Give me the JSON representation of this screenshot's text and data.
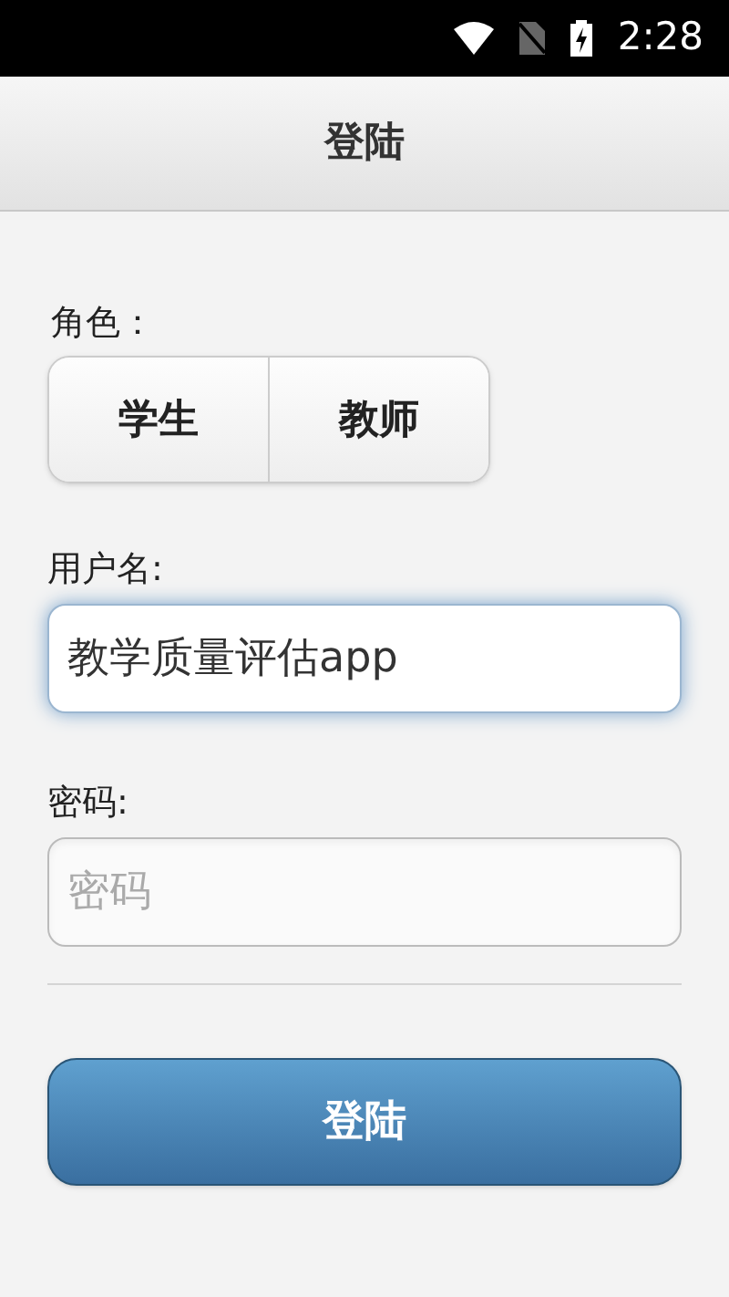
{
  "status_bar": {
    "time": "2:28"
  },
  "header": {
    "title": "登陆"
  },
  "role": {
    "label": "角色：",
    "options": [
      {
        "label": "学生",
        "selected": false
      },
      {
        "label": "教师",
        "selected": false
      }
    ]
  },
  "username": {
    "label": "用户名:",
    "value": "教学质量评估app",
    "focused": true
  },
  "password": {
    "label": "密码:",
    "placeholder": "密码"
  },
  "submit": {
    "label": "登陆"
  }
}
